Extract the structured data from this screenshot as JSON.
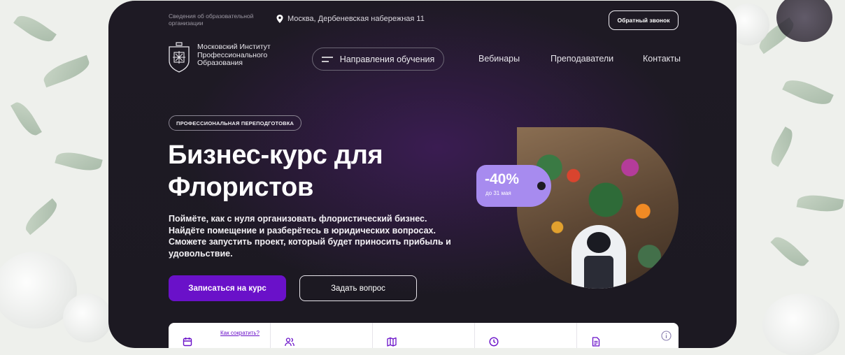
{
  "header": {
    "info_link": "Сведения об образовательной организации",
    "address": "Москва, Дербеневская набережная 11",
    "callback_label": "Обратный звонок"
  },
  "logo": {
    "name": "Московский Институт Профессионального Образования"
  },
  "nav": {
    "directions_label": "Направления обучения",
    "links": [
      "Вебинары",
      "Преподаватели",
      "Контакты"
    ]
  },
  "hero": {
    "badge": "ПРОФЕССИОНАЛЬНАЯ ПЕРЕПОДГОТОВКА",
    "title": "Бизнес-курс для Флористов",
    "description": "Поймёте, как с нуля организовать флористический бизнес. Найдёте помещение и разберётесь в юридических вопросах. Сможете запустить проект, который будет приносить прибыль и удовольствие.",
    "enroll_label": "Записаться на курс",
    "ask_label": "Задать вопрос"
  },
  "discount": {
    "value": "-40%",
    "until": "до 31 мая"
  },
  "info_bar": {
    "shorten_link": "Как сократить?",
    "icons": [
      "calendar-icon",
      "users-icon",
      "map-icon",
      "clock-icon",
      "document-icon"
    ]
  },
  "colors": {
    "accent": "#6a11c9",
    "discount": "#a78bef",
    "card_bg": "#1e1a24"
  }
}
